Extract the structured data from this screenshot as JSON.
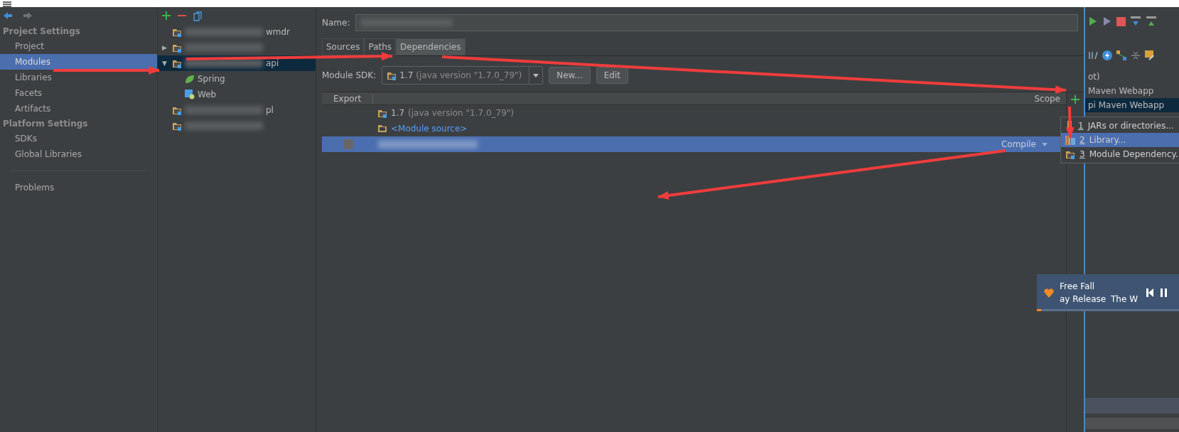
{
  "sidebar": {
    "sections": [
      {
        "title": "Project Settings",
        "items": [
          {
            "label": "Project",
            "selected": false
          },
          {
            "label": "Modules",
            "selected": true
          },
          {
            "label": "Libraries",
            "selected": false
          },
          {
            "label": "Facets",
            "selected": false
          },
          {
            "label": "Artifacts",
            "selected": false
          }
        ]
      },
      {
        "title": "Platform Settings",
        "items": [
          {
            "label": "SDKs",
            "selected": false
          },
          {
            "label": "Global Libraries",
            "selected": false
          }
        ]
      }
    ],
    "footer_items": [
      {
        "label": "Problems",
        "selected": false
      }
    ]
  },
  "module_tree": {
    "items": [
      {
        "label": "wmdr",
        "selected": false
      },
      {
        "toggle": "▶",
        "selected": false
      },
      {
        "label": "api",
        "toggle": "▼",
        "selected": true,
        "children": [
          {
            "label": "Spring",
            "kind": "spring",
            "selected": false
          },
          {
            "label": "Web",
            "kind": "web",
            "selected": false
          }
        ]
      },
      {
        "label": "pl",
        "selected": false
      },
      {
        "selected": false
      }
    ]
  },
  "module": {
    "name_label": "Name:",
    "tabs": [
      {
        "label": "Sources",
        "selected": false
      },
      {
        "label": "Paths",
        "selected": false
      },
      {
        "label": "Dependencies",
        "selected": true
      }
    ],
    "sdk": {
      "label": "Module SDK:",
      "value": "1.7",
      "detail": "(java version \"1.7.0_79\")",
      "buttons": [
        "New...",
        "Edit"
      ]
    },
    "table": {
      "columns": [
        "Export",
        "Scope"
      ],
      "rows": [
        {
          "kind": "sdk",
          "name": "1.7",
          "detail": "(java version \"1.7.0_79\")",
          "selected": false
        },
        {
          "kind": "source",
          "name": "<Module source>",
          "selected": false
        },
        {
          "kind": "library",
          "checked": false,
          "scope": "Compile",
          "selected": true
        }
      ]
    }
  },
  "add_menu": {
    "items": [
      {
        "mnemonic": "1",
        "label": "JARs or directories...",
        "kind": "jars",
        "selected": false
      },
      {
        "mnemonic": "2",
        "label": "Library...",
        "kind": "library",
        "selected": true
      },
      {
        "mnemonic": "3",
        "label": "Module Dependency.",
        "kind": "module",
        "selected": false
      }
    ]
  },
  "right_panel": {
    "items": [
      {
        "label": "ot)",
        "selected": false
      },
      {
        "label": "Maven Webapp",
        "selected": false
      },
      {
        "label": "pi Maven Webapp",
        "selected": true
      }
    ]
  },
  "music_player": {
    "title": "Free Fall",
    "album": "ay Release",
    "artist": "The W",
    "level": 0.03
  }
}
